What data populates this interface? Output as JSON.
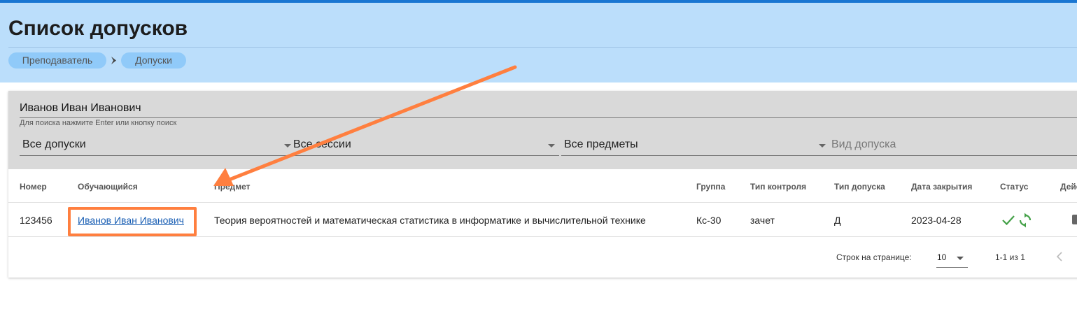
{
  "page": {
    "title": "Список допусков",
    "breadcrumbs": [
      "Преподаватель",
      "Допуски"
    ]
  },
  "filters": {
    "search_value": "Иванов Иван Иванович",
    "search_hint": "Для поиска нажмите Enter или кнопку поиск",
    "admission_select": "Все допуски",
    "session_select": "Все сессии",
    "subject_select": "Все предметы",
    "admission_type_placeholder": "Вид допуска"
  },
  "table": {
    "columns": [
      "Номер",
      "Обучающийся",
      "Предмет",
      "Группа",
      "Тип контроля",
      "Тип допуска",
      "Дата закрытия",
      "Статус",
      "Действия"
    ],
    "rows": [
      {
        "number": "123456",
        "student": "Иванов Иван Иванович",
        "subject": "Теория вероятностей и математическая статистика в информатике и вычислительной технике",
        "group": "Кс-30",
        "control_type": "зачет",
        "admission_type": "Д",
        "close_date": "2023-04-28"
      }
    ]
  },
  "pagination": {
    "rows_per_page_label": "Строк на странице:",
    "rows_per_page_value": "10",
    "range": "1-1 из 1"
  },
  "colors": {
    "header_bg": "#bbdefb",
    "top_bar": "#1976d2",
    "breadcrumb_bg": "#90caf9",
    "highlight": "#ff7f3f",
    "status_green": "#43a047",
    "link": "#1a5fb4"
  },
  "icons": {
    "breadcrumb_separator": "chevron-right-icon",
    "status_approved": "check-icon",
    "status_refresh": "sync-icon",
    "action": "print-icon",
    "pagination_prev": "chevron-left-icon",
    "dropdown": "caret-down-icon"
  }
}
